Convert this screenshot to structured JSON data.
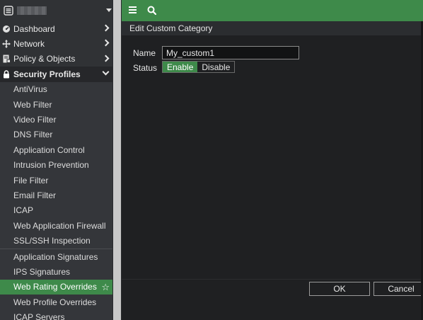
{
  "sidebar": {
    "items": [
      {
        "label": "Dashboard",
        "icon": "dashboard-icon"
      },
      {
        "label": "Network",
        "icon": "network-icon"
      },
      {
        "label": "Policy & Objects",
        "icon": "policy-icon"
      },
      {
        "label": "Security Profiles",
        "icon": "lock-icon"
      }
    ],
    "security_profiles": [
      "AntiVirus",
      "Web Filter",
      "Video Filter",
      "DNS Filter",
      "Application Control",
      "Intrusion Prevention",
      "File Filter",
      "Email Filter",
      "ICAP",
      "Web Application Firewall",
      "SSL/SSH Inspection"
    ],
    "signatures": [
      "Application Signatures",
      "IPS Signatures",
      "Web Rating Overrides",
      "Web Profile Overrides",
      "ICAP Servers"
    ]
  },
  "panel": {
    "title": "Edit Custom Category",
    "name_label": "Name",
    "name_value": "My_custom1",
    "status_label": "Status",
    "status_enable": "Enable",
    "status_disable": "Disable"
  },
  "buttons": {
    "ok": "OK",
    "cancel": "Cancel"
  },
  "colors": {
    "accent": "#3e8a4a",
    "sidebar": "#303235",
    "content": "#1f2022"
  }
}
